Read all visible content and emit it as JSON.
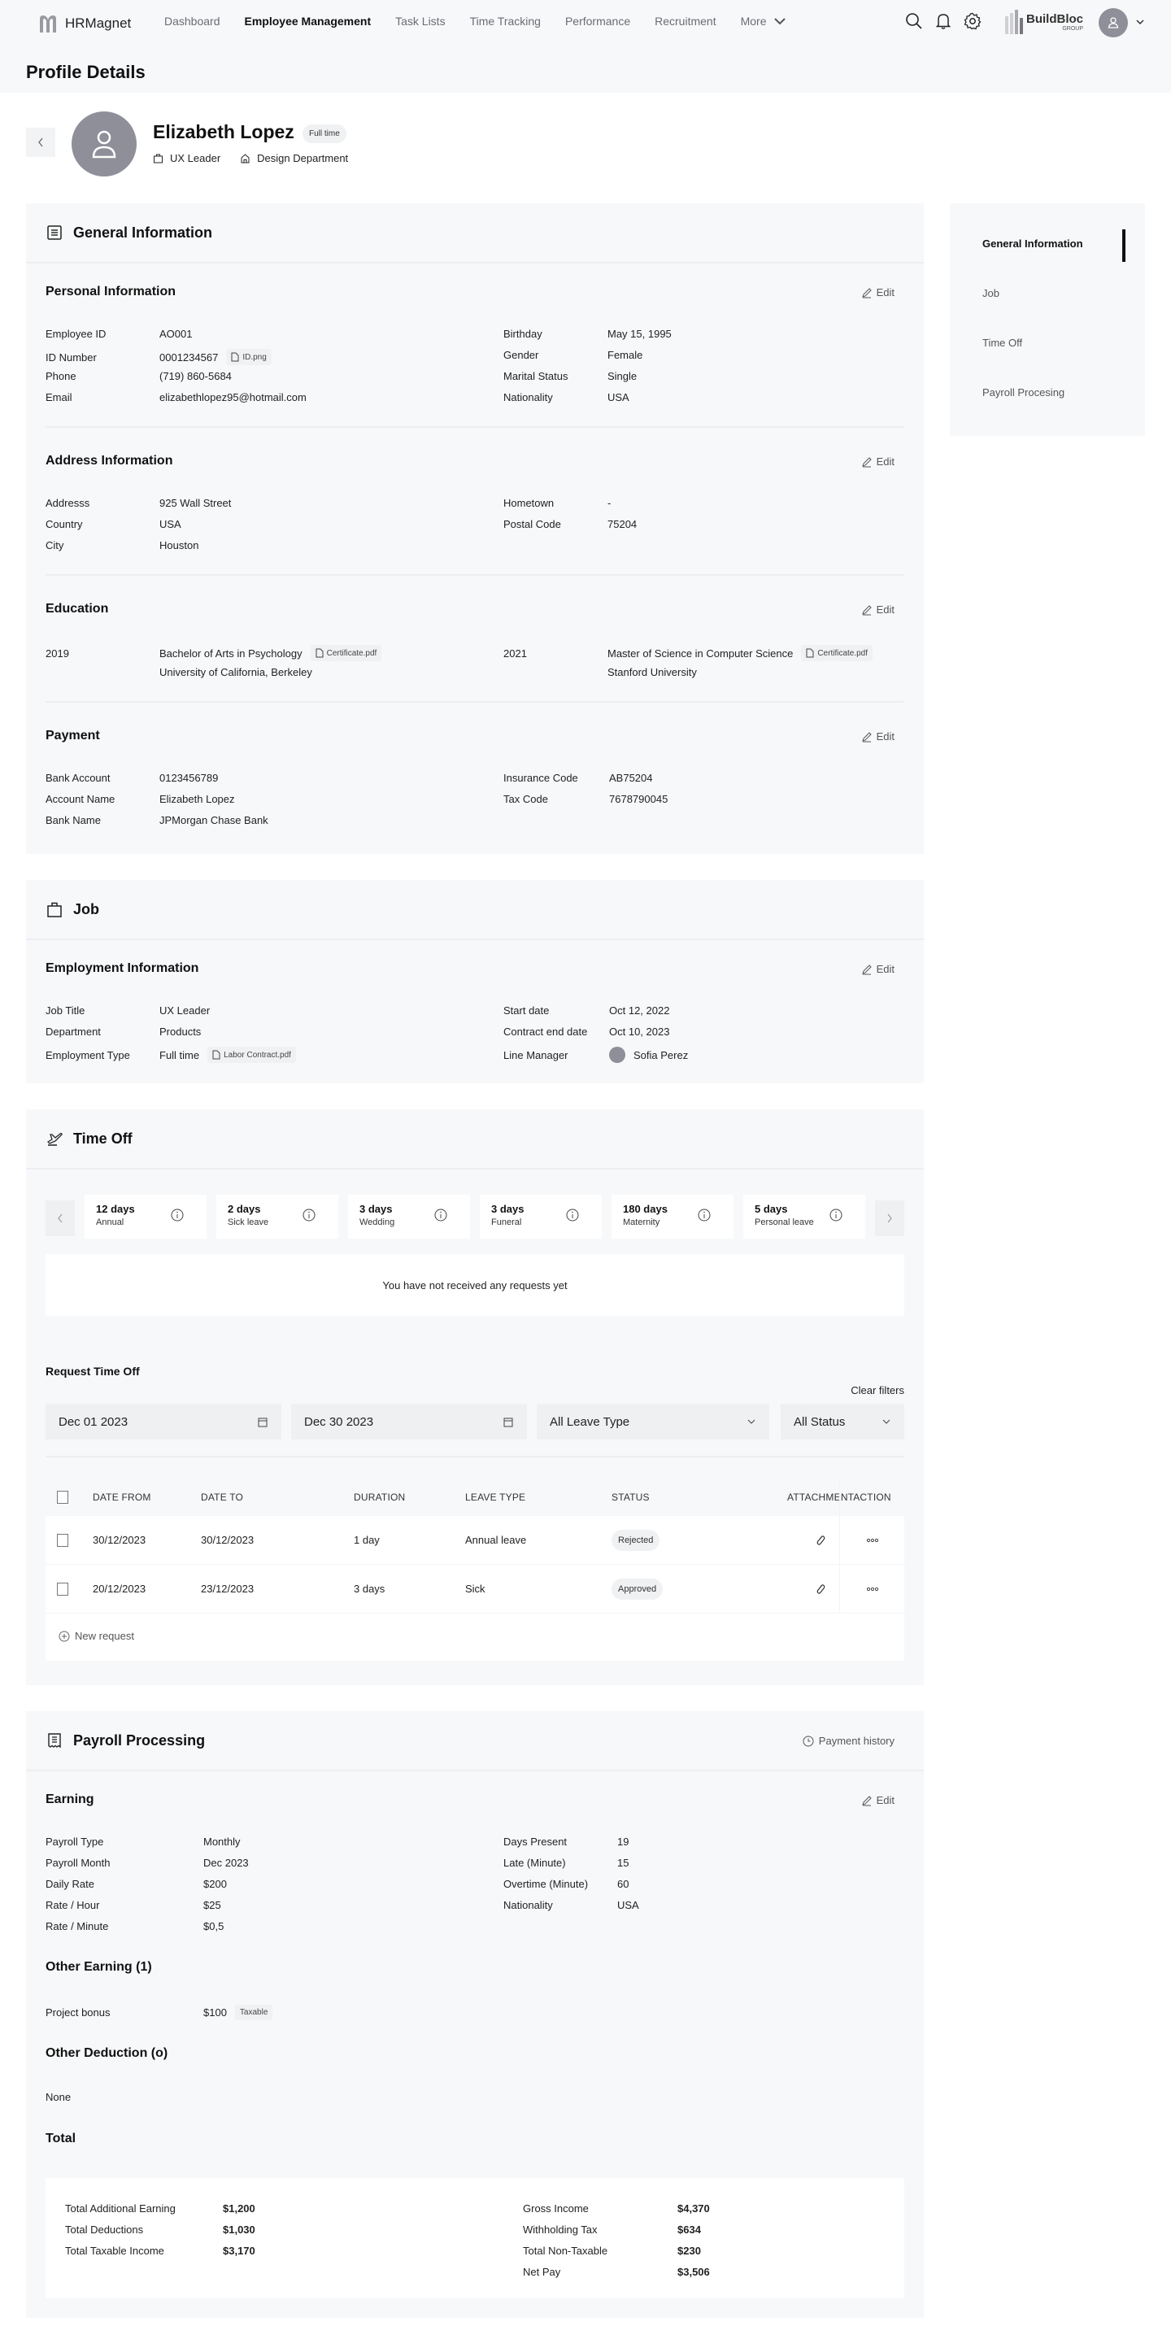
{
  "app": {
    "name": "HRMagnet",
    "nav": [
      "Dashboard",
      "Employee Management",
      "Task Lists",
      "Time Tracking",
      "Performance",
      "Recruitment"
    ],
    "nav_active_index": 1,
    "nav_more": "More",
    "brand_name": "BuildBloc",
    "brand_sub": "GROUP"
  },
  "page": {
    "title": "Profile Details"
  },
  "profile": {
    "name": "Elizabeth Lopez",
    "employment_badge": "Full time",
    "role": "UX Leader",
    "department": "Design Department"
  },
  "sidenav": {
    "items": [
      "General Information",
      "Job",
      "Time Off",
      "Payroll Procesing"
    ],
    "active_index": 0
  },
  "general": {
    "title": "General Information",
    "edit_label": "Edit",
    "personal": {
      "title": "Personal Information",
      "left": [
        {
          "label": "Employee ID",
          "value": "AO001"
        },
        {
          "label": "ID Number",
          "value": "0001234567",
          "file": "ID.png"
        },
        {
          "label": "Phone",
          "value": "(719) 860-5684"
        },
        {
          "label": "Email",
          "value": "elizabethlopez95@hotmail.com"
        }
      ],
      "right": [
        {
          "label": "Birthday",
          "value": "May 15, 1995"
        },
        {
          "label": "Gender",
          "value": "Female"
        },
        {
          "label": "Marital Status",
          "value": "Single"
        },
        {
          "label": "Nationality",
          "value": "USA"
        }
      ]
    },
    "address": {
      "title": "Address Information",
      "left": [
        {
          "label": "Addresss",
          "value": "925 Wall Street"
        },
        {
          "label": "Country",
          "value": "USA"
        },
        {
          "label": "City",
          "value": "Houston"
        }
      ],
      "right": [
        {
          "label": "Hometown",
          "value": "-"
        },
        {
          "label": "Postal Code",
          "value": "75204"
        }
      ]
    },
    "education": {
      "title": "Education",
      "entries": [
        {
          "year": "2019",
          "degree": "Bachelor of Arts in Psychology",
          "file": "Certificate.pdf",
          "school": "University of California, Berkeley"
        },
        {
          "year": "2021",
          "degree": "Master of Science in Computer Science",
          "file": "Certificate.pdf",
          "school": "Stanford University"
        }
      ]
    },
    "payment": {
      "title": "Payment",
      "left": [
        {
          "label": "Bank Account",
          "value": "0123456789"
        },
        {
          "label": "Account Name",
          "value": "Elizabeth Lopez"
        },
        {
          "label": "Bank Name",
          "value": "JPMorgan Chase Bank"
        }
      ],
      "right": [
        {
          "label": "Insurance Code",
          "value": "AB75204"
        },
        {
          "label": "Tax Code",
          "value": "7678790045"
        }
      ]
    }
  },
  "job": {
    "title": "Job",
    "employment": {
      "title": "Employment Information",
      "left": [
        {
          "label": "Job Title",
          "value": "UX Leader"
        },
        {
          "label": "Department",
          "value": "Products"
        },
        {
          "label": "Employment Type",
          "value": "Full time",
          "file": "Labor Contract.pdf"
        }
      ],
      "right": [
        {
          "label": "Start date",
          "value": "Oct 12, 2022"
        },
        {
          "label": "Contract end date",
          "value": "Oct 10, 2023"
        },
        {
          "label": "Line  Manager",
          "value": "Sofia Perez"
        }
      ]
    }
  },
  "timeoff": {
    "title": "Time Off",
    "balances": [
      {
        "days": "12 days",
        "type": "Annual"
      },
      {
        "days": "2 days",
        "type": "Sick leave"
      },
      {
        "days": "3 days",
        "type": "Wedding"
      },
      {
        "days": "3 days",
        "type": "Funeral"
      },
      {
        "days": "180 days",
        "type": "Maternity"
      },
      {
        "days": "5 days",
        "type": "Personal leave"
      }
    ],
    "empty_message": "You have not received any requests yet",
    "request_title": "Request Time Off",
    "clear_filters": "Clear filters",
    "filters": {
      "date_from": "Dec 01  2023",
      "date_to": "Dec 30 2023",
      "leave_type": "All Leave Type",
      "status": "All Status"
    },
    "columns": [
      "DATE FROM",
      "DATE TO",
      "DURATION",
      "LEAVE TYPE",
      "STATUS",
      "ATTACHMENT",
      "ACTION"
    ],
    "rows": [
      {
        "date_from": "30/12/2023",
        "date_to": "30/12/2023",
        "duration": "1 day",
        "leave_type": "Annual leave",
        "status": "Rejected"
      },
      {
        "date_from": "20/12/2023",
        "date_to": "23/12/2023",
        "duration": "3 days",
        "leave_type": "Sick",
        "status": "Approved"
      }
    ],
    "new_request": "New request"
  },
  "payroll": {
    "title": "Payroll Processing",
    "history_label": "Payment history",
    "earning": {
      "title": "Earning",
      "left": [
        {
          "label": "Payroll Type",
          "value": "Monthly"
        },
        {
          "label": "Payroll Month",
          "value": "Dec 2023"
        },
        {
          "label": "Daily Rate",
          "value": "$200"
        },
        {
          "label": "Rate / Hour",
          "value": "$25"
        },
        {
          "label": "Rate / Minute",
          "value": "$0,5"
        }
      ],
      "right": [
        {
          "label": "Days Present",
          "value": "19"
        },
        {
          "label": "Late (Minute)",
          "value": "15"
        },
        {
          "label": "Overtime (Minute)",
          "value": "60"
        },
        {
          "label": "Nationality",
          "value": "USA"
        }
      ]
    },
    "other_earning": {
      "title": "Other Earning (1)",
      "items": [
        {
          "label": "Project bonus",
          "value": "$100",
          "tag": "Taxable"
        }
      ]
    },
    "other_deduction": {
      "title": "Other Deduction (o)",
      "empty": "None"
    },
    "total": {
      "title": "Total",
      "left": [
        {
          "label": "Total Additional Earning",
          "value": "$1,200"
        },
        {
          "label": "Total Deductions",
          "value": "$1,030"
        },
        {
          "label": "Total Taxable Income",
          "value": "$3,170"
        }
      ],
      "right": [
        {
          "label": "Gross Income",
          "value": "$4,370"
        },
        {
          "label": "Withholding Tax",
          "value": "$634"
        },
        {
          "label": "Total Non-Taxable",
          "value": "$230"
        },
        {
          "label": "Net Pay",
          "value": "$3,506"
        }
      ]
    }
  }
}
